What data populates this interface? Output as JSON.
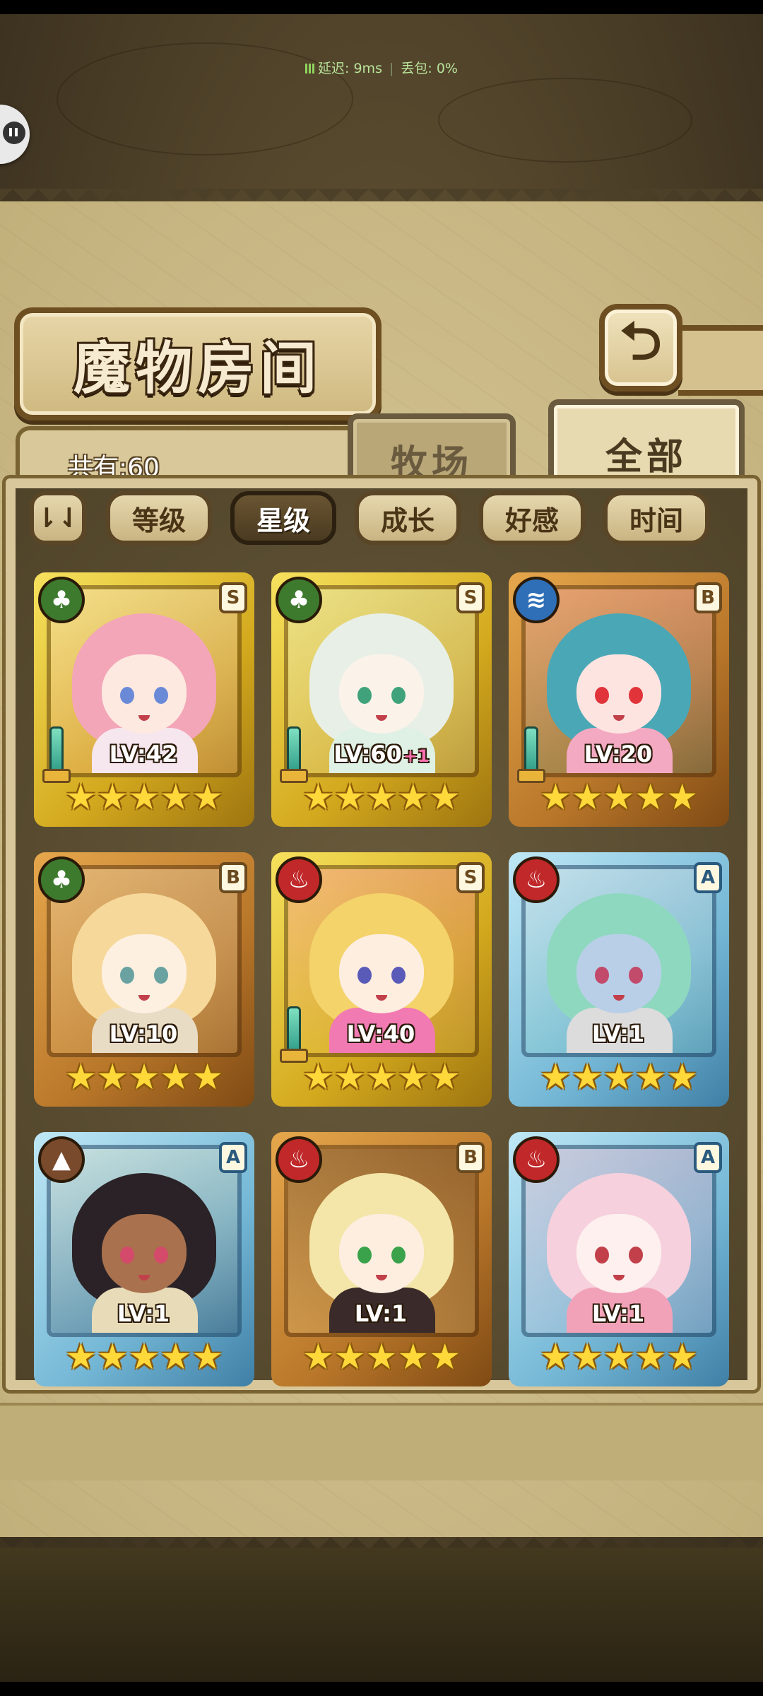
{
  "status": {
    "latency": "延迟: 9ms",
    "packet_loss": "丢包: 0%"
  },
  "header": {
    "title": "魔物房间",
    "back_icon": "return-arrow-icon",
    "back_glyph": "⮌"
  },
  "tabs": {
    "ranch_label": "牧场",
    "all_label": "全部",
    "active": "全部"
  },
  "count_label": "共有:60",
  "sort": {
    "toggle_glyph": "⇂⇃",
    "buttons": [
      "等级",
      "星级",
      "成长",
      "好感",
      "时间"
    ],
    "active": "星级"
  },
  "monsters": [
    {
      "level": "LV:42",
      "bonus": "",
      "rank": "S",
      "element": "leaf",
      "frame": "gold",
      "stars": "★★★★★",
      "has_weapon": true,
      "colors": {
        "hair": "#f3a6b8",
        "face": "#fde9e0",
        "eye": "#6a8ad8",
        "body": "#f6e6ee"
      }
    },
    {
      "level": "LV:60",
      "bonus": "+1",
      "rank": "S",
      "element": "leaf",
      "frame": "gold",
      "stars": "★★★★★",
      "has_weapon": true,
      "colors": {
        "hair": "#e8efe6",
        "face": "#fbf3ea",
        "eye": "#3fa27a",
        "body": "#dff0e4"
      }
    },
    {
      "level": "LV:20",
      "bonus": "",
      "rank": "B",
      "element": "water",
      "frame": "bronze",
      "stars": "★★★★★",
      "has_weapon": true,
      "colors": {
        "hair": "#4aa7b6",
        "face": "#fde4e0",
        "eye": "#e0343a",
        "body": "#f4a9c2"
      }
    },
    {
      "level": "LV:10",
      "bonus": "",
      "rank": "B",
      "element": "leaf",
      "frame": "bronze",
      "stars": "★★★★★",
      "has_weapon": false,
      "colors": {
        "hair": "#f6d89a",
        "face": "#fdf0e0",
        "eye": "#6aa2a2",
        "body": "#e9dcc4"
      }
    },
    {
      "level": "LV:40",
      "bonus": "",
      "rank": "S",
      "element": "fire",
      "frame": "gold",
      "stars": "★★★★★",
      "has_weapon": true,
      "colors": {
        "hair": "#f4d36a",
        "face": "#fdeee0",
        "eye": "#5a5ab8",
        "body": "#f17ab2"
      }
    },
    {
      "level": "LV:1",
      "bonus": "",
      "rank": "A",
      "element": "fire",
      "frame": "blue",
      "stars": "★★★★★",
      "has_weapon": false,
      "colors": {
        "hair": "#8fd8c0",
        "face": "#b9cfe8",
        "eye": "#c24a6a",
        "body": "#dcdcdc"
      }
    },
    {
      "level": "LV:1",
      "bonus": "",
      "rank": "A",
      "element": "earth",
      "frame": "blue",
      "stars": "★★★★★",
      "has_weapon": false,
      "colors": {
        "hair": "#2a2226",
        "face": "#a9714e",
        "eye": "#d44a6a",
        "body": "#e8dcb8"
      }
    },
    {
      "level": "LV:1",
      "bonus": "",
      "rank": "B",
      "element": "fire",
      "frame": "bronze",
      "stars": "★★★★★",
      "has_weapon": false,
      "colors": {
        "hair": "#f3e6a8",
        "face": "#fdeee0",
        "eye": "#3aa24a",
        "body": "#3a2a2a"
      }
    },
    {
      "level": "LV:1",
      "bonus": "",
      "rank": "A",
      "element": "fire",
      "frame": "blue",
      "stars": "★★★★★",
      "has_weapon": false,
      "colors": {
        "hair": "#f6d0dc",
        "face": "#fdf0ee",
        "eye": "#c2404a",
        "body": "#f2a2b8"
      }
    }
  ],
  "element_glyphs": {
    "leaf": "♣",
    "water": "≋",
    "fire": "♨",
    "earth": "▲"
  }
}
